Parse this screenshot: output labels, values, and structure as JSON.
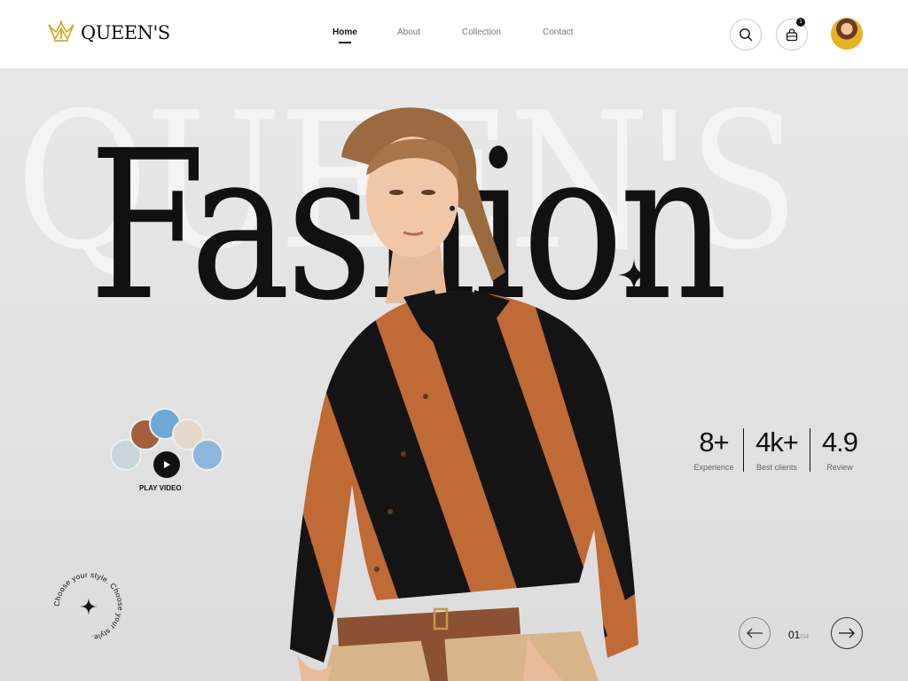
{
  "brand": {
    "name": "QUEEN'S",
    "color": "#d4a21c"
  },
  "nav": {
    "items": [
      {
        "label": "Home",
        "active": true
      },
      {
        "label": "About",
        "active": false
      },
      {
        "label": "Collection",
        "active": false
      },
      {
        "label": "Contact",
        "active": false
      }
    ]
  },
  "header_actions": {
    "search_icon": "search-icon",
    "bag_icon": "shopping-bag-icon",
    "bag_count": "1",
    "avatar": "user-avatar"
  },
  "hero": {
    "watermark": "QUEEN'S",
    "headline": "Fashion",
    "play_label": "PLAY VIDEO",
    "badge_text": "Choose your style. Choose your style.",
    "stats": [
      {
        "value": "8+",
        "label": "Experience"
      },
      {
        "value": "4k+",
        "label": "Best clients"
      },
      {
        "value": "4.9",
        "label": "Review"
      }
    ],
    "slider": {
      "current": "01",
      "total": "/04"
    }
  },
  "colors": {
    "background": "#e4e4e4",
    "text": "#111111",
    "accent": "#d4a21c"
  }
}
